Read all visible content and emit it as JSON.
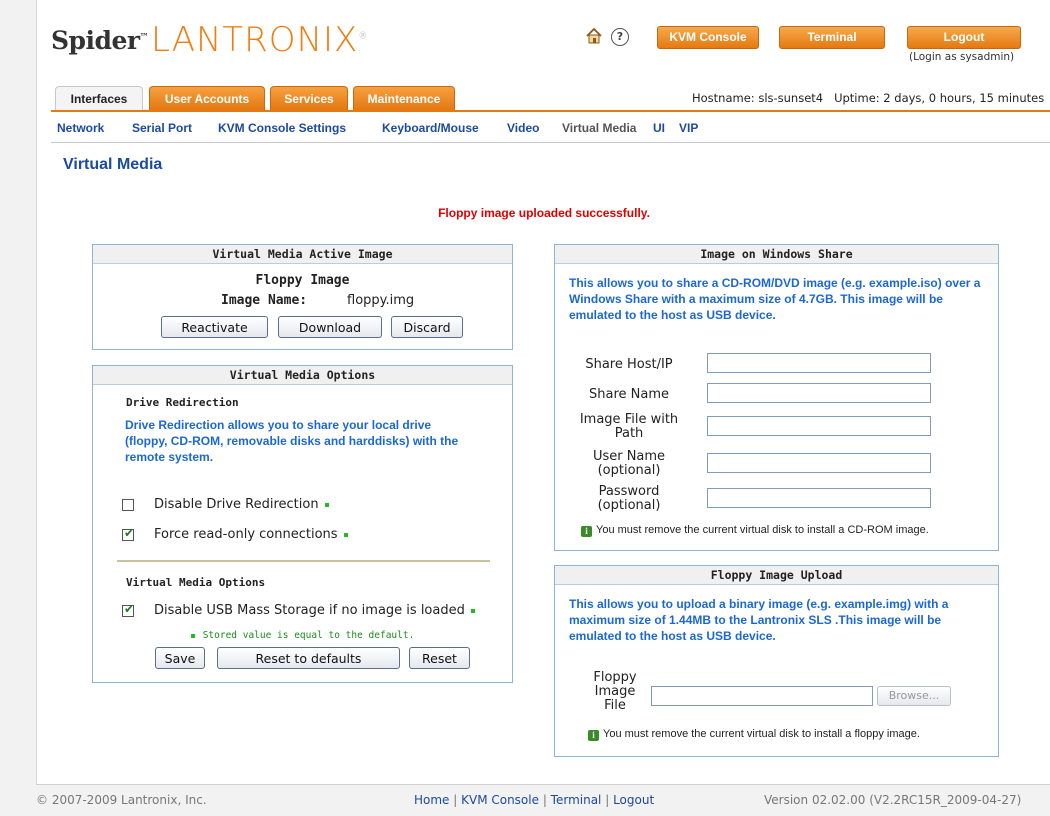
{
  "header": {
    "logo_spider": "Spider",
    "logo_lantronix": "LANTRONIX",
    "kvm_console_btn": "KVM Console",
    "terminal_btn": "Terminal",
    "logout_btn": "Logout",
    "login_as": "(Login as sysadmin)"
  },
  "tabs": [
    {
      "label": "Interfaces",
      "active": true
    },
    {
      "label": "User Accounts",
      "active": false
    },
    {
      "label": "Services",
      "active": false
    },
    {
      "label": "Maintenance",
      "active": false
    }
  ],
  "host_info": "Hostname: sls-sunset4   Uptime: 2 days, 0 hours, 15 minutes",
  "subnav": [
    "Network",
    "Serial Port",
    "KVM Console Settings",
    "Keyboard/Mouse",
    "Video",
    "Virtual Media",
    "UI",
    "VIP"
  ],
  "page_title": "Virtual Media",
  "success_message": "Floppy image uploaded successfully.",
  "active_image": {
    "title": "Virtual Media Active Image",
    "type": "Floppy Image",
    "name_label": "Image Name:",
    "name_value": "floppy.img",
    "reactivate": "Reactivate",
    "download": "Download",
    "discard": "Discard"
  },
  "options": {
    "title": "Virtual Media Options",
    "drive_heading": "Drive Redirection",
    "drive_desc": "Drive Redirection allows you to share your local drive (floppy, CD-ROM, removable disks and harddisks) with the remote system.",
    "disable_drive": "Disable Drive Redirection",
    "disable_drive_checked": false,
    "force_readonly": "Force read-only connections",
    "force_readonly_checked": true,
    "vm_heading": "Virtual Media Options",
    "disable_usb": "Disable USB Mass Storage if no image is loaded",
    "disable_usb_checked": true,
    "stored_note": "Stored value is equal to the default.",
    "save": "Save",
    "reset_defaults": "Reset to defaults",
    "reset": "Reset"
  },
  "windows_share": {
    "title": "Image on Windows Share",
    "desc": "This allows you to share a CD-ROM/DVD image (e.g. example.iso) over a Windows Share with a maximum size of 4.7GB. This image will be emulated to the host as USB device.",
    "share_host": "Share Host/IP",
    "share_name": "Share Name",
    "image_file_1": "Image File with",
    "image_file_2": "Path",
    "user_name_1": "User Name",
    "user_name_2": "(optional)",
    "password_1": "Password",
    "password_2": "(optional)",
    "note": "You must remove the current virtual disk to install a CD-ROM image."
  },
  "floppy_upload": {
    "title": "Floppy Image Upload",
    "desc": "This allows you to upload a binary image (e.g. example.img) with a maximum size of 1.44MB to the Lantronix SLS .This image will be emulated to the host as USB device.",
    "label_1": "Floppy",
    "label_2": "Image",
    "label_3": "File",
    "browse": "Browse...",
    "note": "You must remove the current virtual disk to install a floppy image."
  },
  "footer": {
    "copyright": "© 2007-2009 Lantronix, Inc.",
    "links": [
      "Home",
      "KVM Console",
      "Terminal",
      "Logout"
    ],
    "version": "Version 02.02.00 (V2.2RC15R_2009-04-27)"
  }
}
